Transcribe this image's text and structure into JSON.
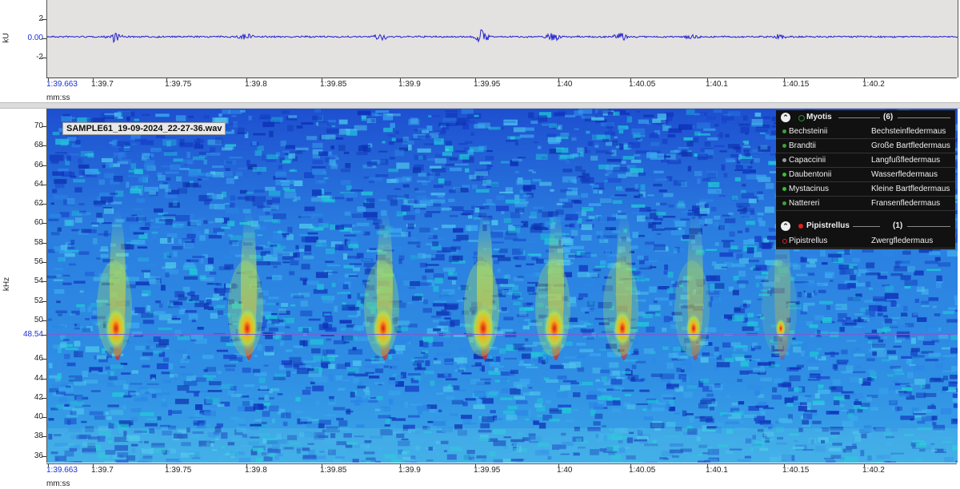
{
  "waveform": {
    "unit_label": "kU",
    "y_ticks": [
      "2",
      "0.00",
      "-2"
    ],
    "x_ticks": [
      "1:39.663",
      "1:39.7",
      "1:39.75",
      "1:39.8",
      "1:39.85",
      "1:39.9",
      "1:39.95",
      "1:40",
      "1:40.05",
      "1:40.1",
      "1:40.15",
      "1:40.2"
    ],
    "x_unit": "mm:ss",
    "trace_color": "#2222cc"
  },
  "spectrogram": {
    "file_label": "SAMPLE61_19-09-2024_22-27-36.wav",
    "unit_label": "kHz",
    "y_ticks": [
      "70",
      "68",
      "66",
      "64",
      "62",
      "60",
      "58",
      "56",
      "54",
      "52",
      "50",
      "48.54",
      "46",
      "44",
      "42",
      "40",
      "38",
      "36"
    ],
    "cursor_value": "48.54",
    "x_ticks": [
      "1:39.663",
      "1:39.7",
      "1:39.75",
      "1:39.8",
      "1:39.85",
      "1:39.9",
      "1:39.95",
      "1:40",
      "1:40.05",
      "1:40.1",
      "1:40.15",
      "1:40.2"
    ],
    "x_unit": "mm:ss"
  },
  "species_panel": {
    "groups": [
      {
        "name": "Myotis",
        "count": "(6)",
        "dot_color": "#2e8b2e",
        "items": [
          {
            "latin": "Bechsteinii",
            "german": "Bechsteinfledermaus",
            "dot_color": "#3ca03c"
          },
          {
            "latin": "Brandtii",
            "german": "Große Bartfledermaus",
            "dot_color": "#3ca03c"
          },
          {
            "latin": "Capaccinii",
            "german": "Langfußfledermaus",
            "dot_color": "#9a9a9a"
          },
          {
            "latin": "Daubentonii",
            "german": "Wasserfledermaus",
            "dot_color": "#34c234"
          },
          {
            "latin": "Mystacinus",
            "german": "Kleine Bartfledermaus",
            "dot_color": "#34c234"
          },
          {
            "latin": "Nattereri",
            "german": "Fransenfledermaus",
            "dot_color": "#3ca03c"
          }
        ]
      },
      {
        "name": "Pipistrellus",
        "count": "(1)",
        "dot_color": "#e02020",
        "items": [
          {
            "latin": "Pipistrellus",
            "german": "Zwergfledermaus",
            "dot_color": "#e02020"
          }
        ]
      }
    ]
  }
}
